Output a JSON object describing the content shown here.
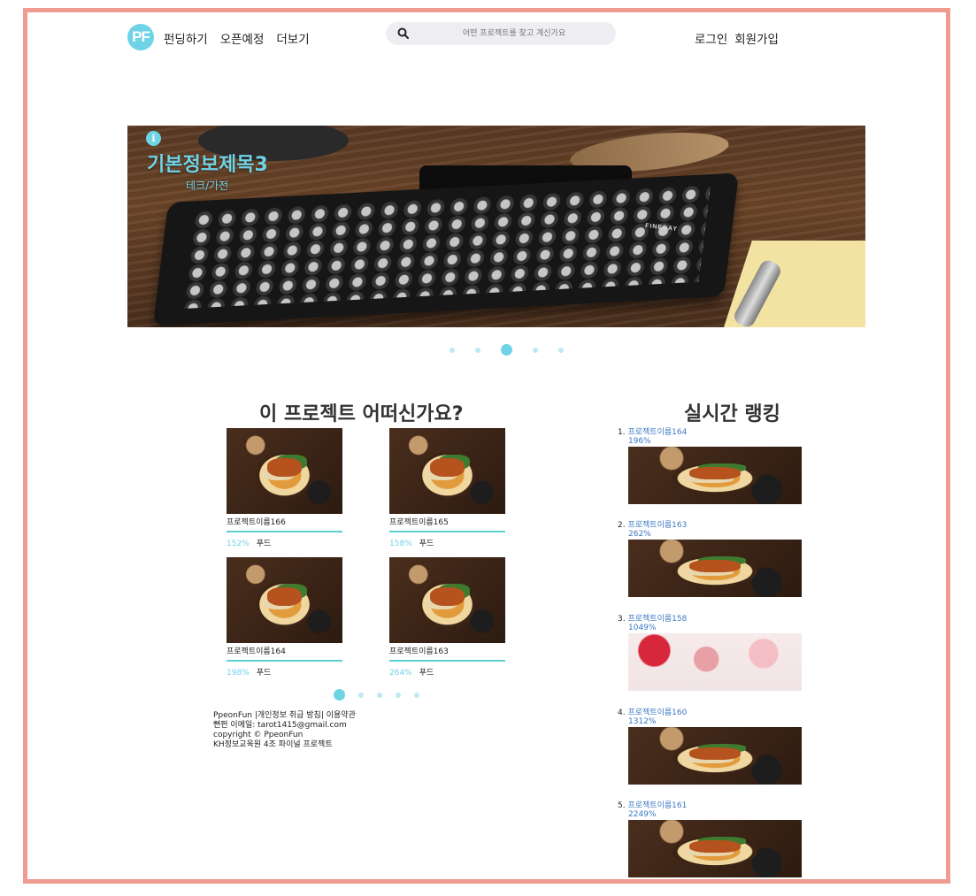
{
  "header": {
    "logo": "PF",
    "nav_left": [
      "펀딩하기",
      "오픈예정",
      "더보기"
    ],
    "search_placeholder": "어떤 프로젝트를 찾고 계신가요",
    "nav_right": [
      "로그인",
      "회원가입"
    ]
  },
  "banner": {
    "title": "기본정보제목3",
    "category": "테크/가전",
    "keyboard_text": "FINEDAY",
    "slides": 5,
    "active_slide": 3
  },
  "recommend": {
    "heading": "이 프로젝트 어떠신가요?",
    "cards": [
      {
        "name": "프로젝트이름166",
        "percent": "152%",
        "category": "푸드"
      },
      {
        "name": "프로젝트이름165",
        "percent": "158%",
        "category": "푸드"
      },
      {
        "name": "프로젝트이름164",
        "percent": "198%",
        "category": "푸드"
      },
      {
        "name": "프로젝트이름163",
        "percent": "264%",
        "category": "푸드"
      }
    ],
    "pages": 5,
    "active_page": 1
  },
  "footer": {
    "line1": "PpeonFun |개인정보 취급 방침| 이용약관",
    "line2": "뻔펀 이메일: tarot1415@gmail.com",
    "line3": "copyright © PpeonFun",
    "line4": "KH정보교육원 4조 파이널 프로젝트"
  },
  "ranking": {
    "heading": "실시간 랭킹",
    "items": [
      {
        "rank": "1.",
        "name": "프로젝트이름164",
        "percent": "196%",
        "image": "food"
      },
      {
        "rank": "2.",
        "name": "프로젝트이름163",
        "percent": "262%",
        "image": "food"
      },
      {
        "rank": "3.",
        "name": "프로젝트이름158",
        "percent": "1049%",
        "image": "flowers"
      },
      {
        "rank": "4.",
        "name": "프로젝트이름160",
        "percent": "1312%",
        "image": "food"
      },
      {
        "rank": "5.",
        "name": "프로젝트이름161",
        "percent": "2249%",
        "image": "food"
      }
    ]
  },
  "colors": {
    "frame_border": "#ef9b8f",
    "accent": "#6fd3e6",
    "link": "#3a78c2",
    "progress": "#5ad1cf"
  }
}
